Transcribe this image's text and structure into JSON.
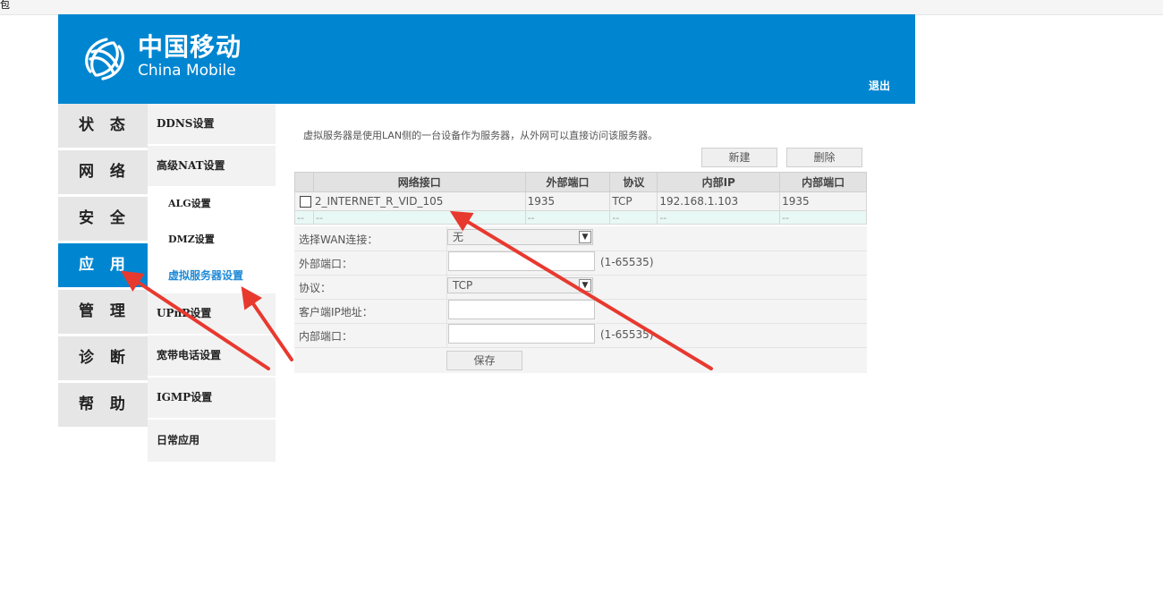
{
  "browser": {
    "corner_text": "包"
  },
  "header": {
    "brand_cn": "中国移动",
    "brand_en": "China Mobile",
    "logout": "退出",
    "bg_color": "#0086d1"
  },
  "main_nav": {
    "items": [
      "状 态",
      "网 络",
      "安 全",
      "应 用",
      "管 理",
      "诊 断",
      "帮 助"
    ],
    "active": "应 用"
  },
  "sub_nav": {
    "items": [
      "DDNS设置",
      "高级NAT设置",
      "UPnP设置",
      "宽带电话设置",
      "IGMP设置",
      "日常应用"
    ],
    "nat_children": [
      "ALG设置",
      "DMZ设置",
      "虚拟服务器设置"
    ],
    "active": "虚拟服务器设置"
  },
  "content": {
    "description": "虚拟服务器是使用LAN侧的一台设备作为服务器，从外网可以直接访问该服务器。",
    "buttons": {
      "new": "新建",
      "delete": "删除"
    },
    "table": {
      "headers": [
        "网络接口",
        "外部端口",
        "协议",
        "内部IP",
        "内部端口"
      ],
      "rows": [
        [
          "2_INTERNET_R_VID_105",
          "1935",
          "TCP",
          "192.168.1.103",
          "1935"
        ],
        [
          "--",
          "--",
          "--",
          "--",
          "--"
        ]
      ],
      "row2_first_cell": "--"
    },
    "form": {
      "wan_label": "选择WAN连接：",
      "wan_value": "无",
      "ext_port_label": "外部端口：",
      "ext_port_value": "",
      "ext_port_hint": "(1-65535)",
      "protocol_label": "协议：",
      "protocol_value": "TCP",
      "client_ip_label": "客户端IP地址：",
      "client_ip_value": "",
      "int_port_label": "内部端口：",
      "int_port_value": "",
      "int_port_hint": "(1-65535)",
      "save": "保存"
    }
  },
  "annotation": {
    "arrow_color": "#e8392f"
  }
}
